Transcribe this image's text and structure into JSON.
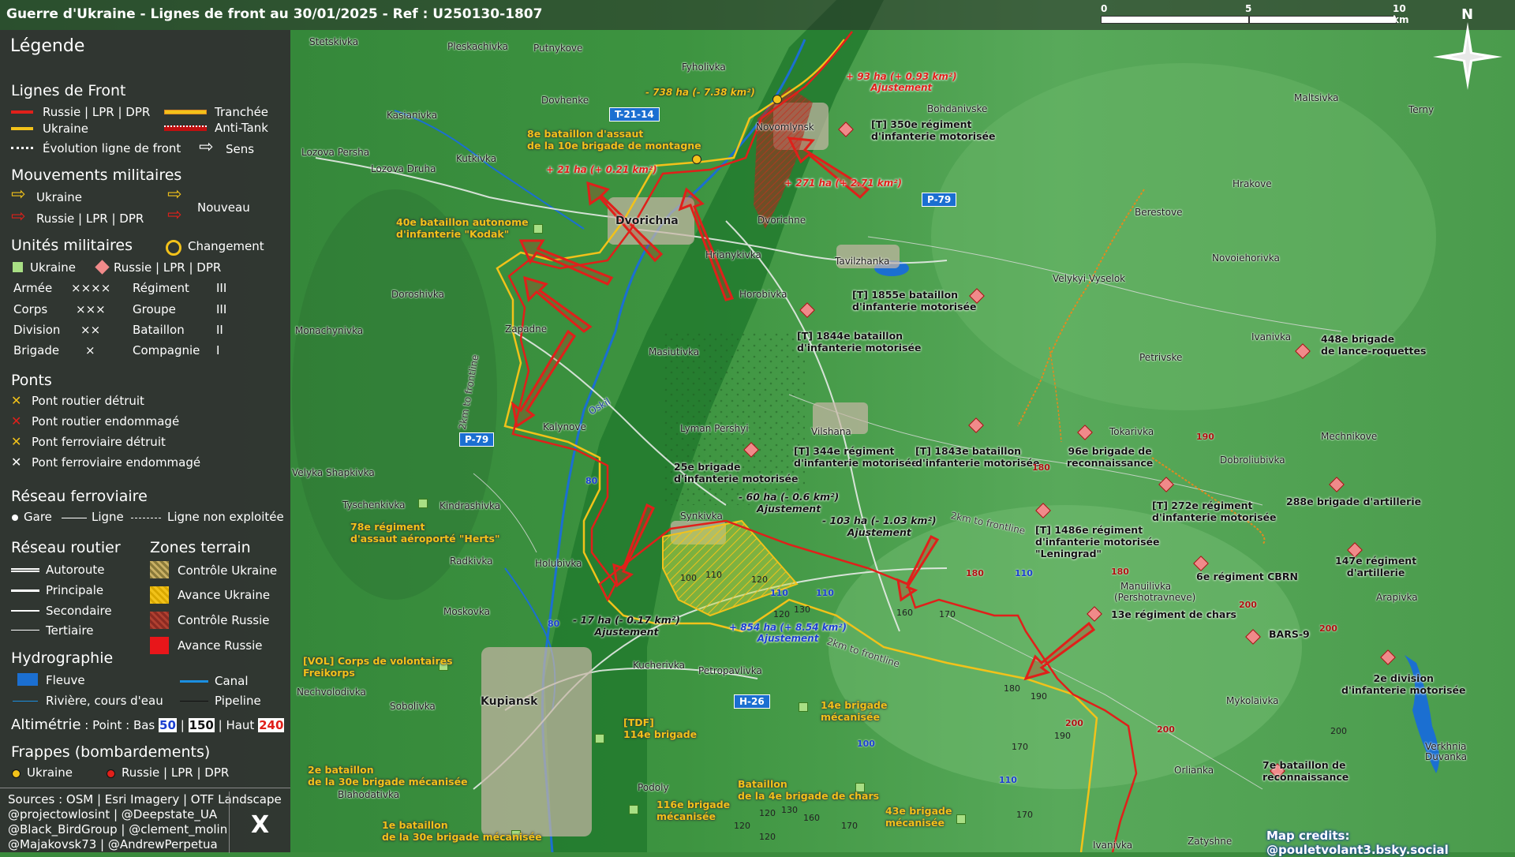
{
  "title": "Guerre d'Ukraine - Lignes de front au 30/01/2025 - Ref : U250130-1807",
  "scale": {
    "labels": [
      "0",
      "5",
      "10 km"
    ]
  },
  "north_label": "N",
  "legend": {
    "title": "Légende",
    "front_lines": {
      "heading": "Lignes de Front",
      "russia": "Russie | LPR | DPR",
      "ukraine": "Ukraine",
      "evolution": "Évolution ligne de front",
      "trench": "Tranchée",
      "antitank": "Anti-Tank",
      "direction": "Sens"
    },
    "movements": {
      "heading": "Mouvements militaires",
      "ukraine": "Ukraine",
      "russia": "Russie | LPR | DPR",
      "new": "Nouveau"
    },
    "units": {
      "heading": "Unités militaires",
      "change": "Changement",
      "ukraine": "Ukraine",
      "russia": "Russie | LPR | DPR",
      "rows": [
        {
          "left": "Armée",
          "lsym": "××××",
          "right": "Régiment",
          "rsym": "III"
        },
        {
          "left": "Corps",
          "lsym": "×××",
          "right": "Groupe",
          "rsym": "III"
        },
        {
          "left": "Division",
          "lsym": "××",
          "right": "Bataillon",
          "rsym": "II"
        },
        {
          "left": "Brigade",
          "lsym": "×",
          "right": "Compagnie",
          "rsym": "I"
        }
      ]
    },
    "bridges": {
      "heading": "Ponts",
      "items": [
        "Pont routier détruit",
        "Pont routier endommagé",
        "Pont ferroviaire détruit",
        "Pont ferroviaire endommagé"
      ]
    },
    "rail": {
      "heading": "Réseau ferroviaire",
      "station": "Gare",
      "line": "Ligne",
      "unused": "Ligne non exploitée"
    },
    "roads": {
      "heading": "Réseau routier",
      "items": [
        "Autoroute",
        "Principale",
        "Secondaire",
        "Tertiaire"
      ]
    },
    "zones": {
      "heading": "Zones terrain",
      "items": [
        "Contrôle Ukraine",
        "Avance Ukraine",
        "Contrôle Russie",
        "Avance Russie"
      ]
    },
    "hydro": {
      "heading": "Hydrographie",
      "river": "Fleuve",
      "canal": "Canal",
      "stream": "Rivière, cours d'eau",
      "pipeline": "Pipeline"
    },
    "altimetry": {
      "prefix": "Altimétrie",
      "text": ": Point : Bas",
      "low": "50",
      "sep1": "|",
      "mid": "150",
      "sep2": "| Haut",
      "high": "240"
    },
    "strikes": {
      "heading": "Frappes (bombardements)",
      "ukraine": "Ukraine",
      "russia": "Russie | LPR | DPR"
    },
    "sources": [
      "Sources : OSM | Esri Imagery | OTF Landscape",
      "@projectowlosint | @Deepstate_UA",
      "@Black_BirdGroup | @clement_molin",
      "@Majakovsk73 | @AndrewPerpetua"
    ],
    "x_logo": "X"
  },
  "colors": {
    "russia": "#e0201a",
    "ukraine": "#f2c21a",
    "legend_bg": "#303030",
    "terrain": "#3b8b3d"
  },
  "map": {
    "places": [
      "Stetskivka",
      "Pleskachivka",
      "Putnykove",
      "Fyholivka",
      "Dovhenke",
      "Kasianivka",
      "Kutkivka",
      "Lozova Persha",
      "Lozova Druha",
      "Novomlynsk",
      "Bohdanivske",
      "Dvorichna",
      "Dvorichne",
      "Hrianykivka",
      "Tavilzhanka",
      "Doroshivka",
      "Zapadne",
      "Horobivka",
      "Monachynivka",
      "Masiutivka",
      "Kalynove",
      "Lyman Pershyi",
      "Vilshana",
      "Synkivka",
      "Tyschenkivka",
      "Kindrashivka",
      "Velyka Shapkivka",
      "Radkivka",
      "Holubivka",
      "Moskovka",
      "Kucherivka",
      "Petropavlivka",
      "Kupiansk",
      "Nechvolodivka",
      "Sobolivka",
      "Blahodativka",
      "Podoly",
      "Maltsivka",
      "Terny",
      "Hrakove",
      "Berestove",
      "Novoiehorivka",
      "Velykyi Vyselok",
      "Petrivske",
      "Ivanivka",
      "Tokarivka",
      "Mechnikove",
      "Dobroliubivka",
      "Manuilivka",
      "(Pershotravneve)",
      "Arapivka",
      "Mykolaivka",
      "Orlianka",
      "Zatyshne",
      "Verkhnia Duvanka",
      "Oskil",
      "Ivanivka"
    ],
    "roads": [
      "T-21-14",
      "P-79",
      "P-79",
      "H-26"
    ],
    "frontline_labels": [
      "2km to frontline",
      "2km to frontline",
      "2km to frontline"
    ],
    "russian_units": [
      "[T] 350e régiment\nd'infanterie motorisée",
      "[T] 1855e bataillon\nd'infanterie motorisée",
      "[T] 1844e bataillon\nd'infanterie motorisée",
      "448e brigade\nde lance-roquettes",
      "[T] 344e régiment\nd'infanterie motorisée",
      "[T] 1843e bataillon\nd'infanterie motorisée",
      "96e brigade de\nreconnaissance",
      "[T] 272e régiment\nd'infanterie motorisée",
      "288e brigade d'artillerie",
      "[T] 1486e régiment\nd'infanterie motorisée\n\"Leningrad\"",
      "6e régiment CBRN",
      "147e régiment\nd'artillerie",
      "13e régiment de chars",
      "BARS-9",
      "2e division\nd'infanterie motorisée",
      "7e bataillon de\nreconnaissance",
      "25e brigade\nd'infanterie motorisée"
    ],
    "ukrainian_units": [
      "8e bataillon d'assaut\nde la 10e brigade de montagne",
      "40e bataillon autonome\nd'infanterie \"Kodak\"",
      "78e régiment\nd'assaut aéroporté \"Herts\"",
      "[VOL] Corps de volontaires\nFreikorps",
      "14e brigade\nmécanisée",
      "[TDF]\n114e brigade",
      "2e bataillon\nde la 30e brigade mécanisée",
      "Bataillon\nde la 4e brigade de chars",
      "116e brigade\nmécanisée",
      "43e brigade\nmécanisée",
      "1e bataillon\nde la 30e brigade mécanisée"
    ],
    "area_changes": [
      {
        "text": "- 738 ha (- 7.38 km²)",
        "side": "ukraine"
      },
      {
        "text": "+ 93 ha (+ 0.93 km²)\nAjustement",
        "side": "russia"
      },
      {
        "text": "+ 21 ha (+ 0.21 km²)",
        "side": "russia"
      },
      {
        "text": "+ 271 ha (+ 2.71 km²)",
        "side": "russia"
      },
      {
        "text": "- 60 ha (- 0.6 km²)\nAjustement",
        "side": "neutral"
      },
      {
        "text": "- 103 ha (- 1.03 km²)\nAjustement",
        "side": "neutral"
      },
      {
        "text": "- 17 ha (- 0.17 km²)\nAjustement",
        "side": "neutral"
      },
      {
        "text": "+ 854 ha (+ 8.54 km²)\nAjustement",
        "side": "blue"
      }
    ],
    "elevations_red": [
      "190",
      "180",
      "180",
      "180",
      "200",
      "200",
      "200",
      "200"
    ],
    "elevations_blue": [
      "80",
      "80",
      "110",
      "110",
      "110",
      "100",
      "110"
    ],
    "elevations_black": [
      "100",
      "110",
      "120",
      "120",
      "130",
      "160",
      "170",
      "180",
      "190",
      "170",
      "190",
      "160",
      "170",
      "120",
      "120",
      "120",
      "130",
      "200",
      "170"
    ]
  },
  "credits": "Map credits: @pouletvolant3.bsky.social"
}
